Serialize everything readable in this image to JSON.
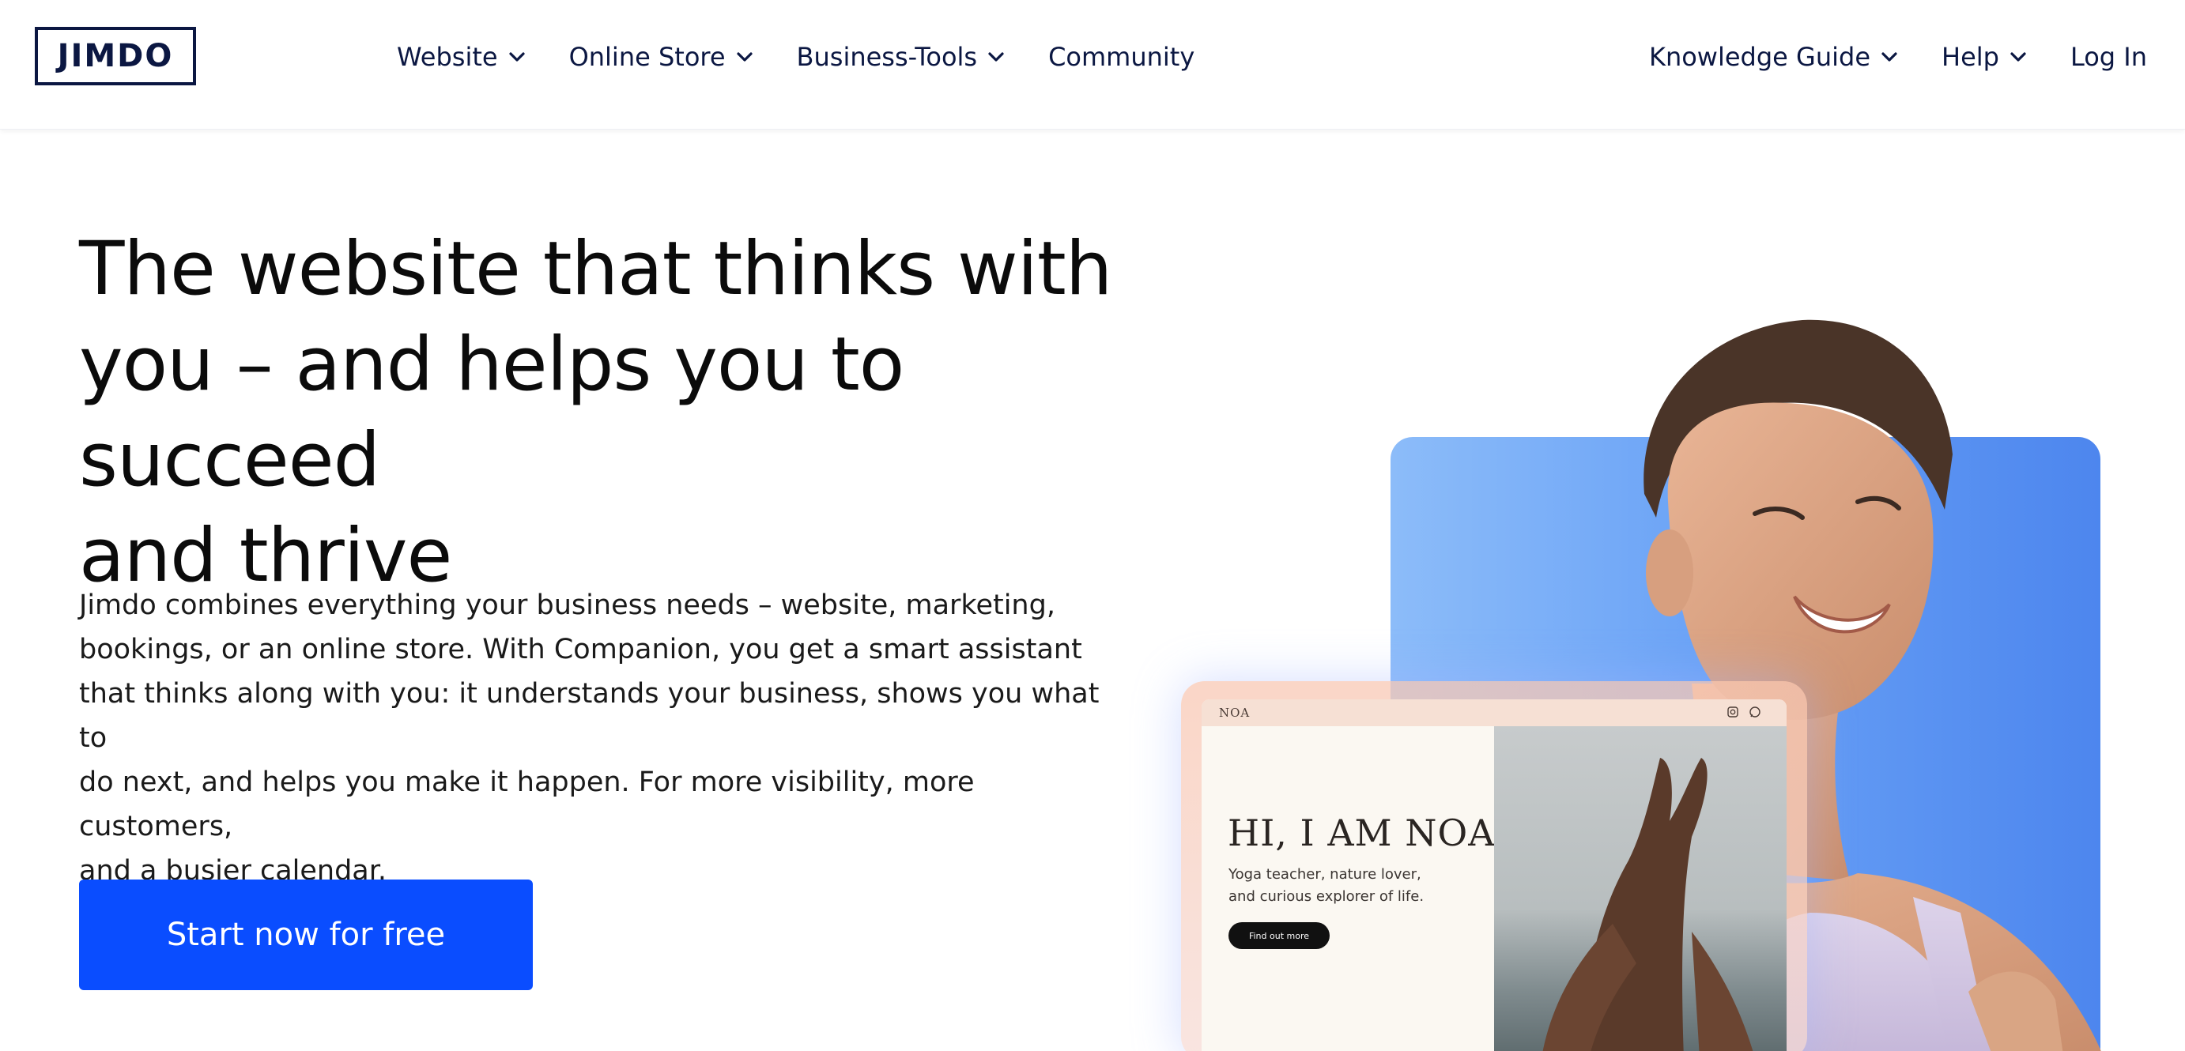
{
  "header": {
    "logo": "JIMDO",
    "nav_left": [
      {
        "label": "Website",
        "has_dropdown": true
      },
      {
        "label": "Online Store",
        "has_dropdown": true
      },
      {
        "label": "Business-Tools",
        "has_dropdown": true
      },
      {
        "label": "Community",
        "has_dropdown": false
      }
    ],
    "nav_right": [
      {
        "label": "Knowledge Guide",
        "has_dropdown": true
      },
      {
        "label": "Help",
        "has_dropdown": true
      },
      {
        "label": "Log In",
        "has_dropdown": false
      }
    ]
  },
  "hero": {
    "headline_lines": [
      "The website that thinks with",
      "you – and helps you to succeed",
      "and thrive"
    ],
    "intro_lines": [
      "Jimdo combines everything your business needs – website, marketing,",
      "bookings, or an online store. With Companion, you get a smart assistant",
      "that thinks along with you: it understands your business, shows you what to",
      "do next, and helps you make it happen. For more visibility, more customers,",
      "and a busier calendar."
    ],
    "cta_label": "Start now for free"
  },
  "mockup": {
    "brand": "NOA",
    "title": "HI, I AM NOA",
    "subtitle_lines": [
      "Yoga teacher, nature lover,",
      "and curious explorer of life."
    ],
    "button_label": "Find out more",
    "icons": [
      "instagram-icon",
      "whatsapp-icon"
    ]
  },
  "colors": {
    "navy": "#0b1742",
    "cta_blue": "#0a4dff",
    "panel_blue": "#4d86ee"
  }
}
